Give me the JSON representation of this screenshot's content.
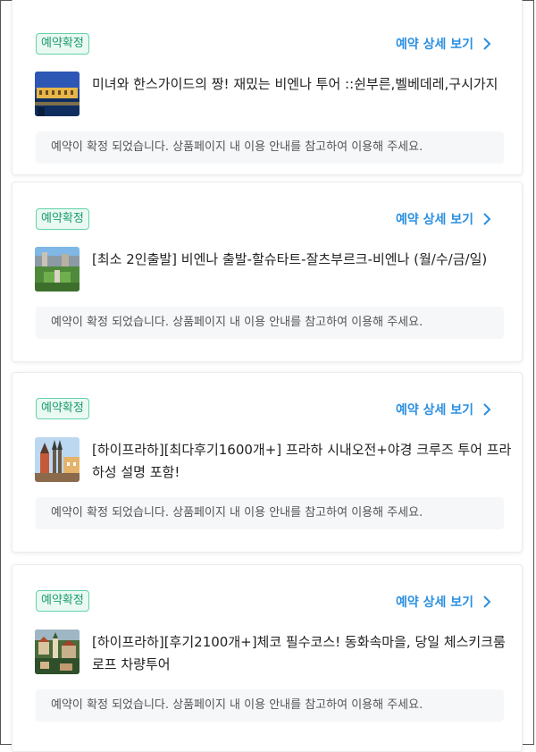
{
  "reservations": [
    {
      "status": "예약확정",
      "detail_link": "예약 상세 보기",
      "title": "미녀와 한스가이드의 짱! 재밌는 비엔나 투어 ::쉰부른,벨베데레,구시가지",
      "notice": "예약이 확정 되었습니다. 상품페이지 내 이용 안내를 참고하여 이용해 주세요.",
      "thumbnail": "schonbrunn-palace-photo"
    },
    {
      "status": "예약확정",
      "detail_link": "예약 상세 보기",
      "title": "[최소 2인출발] 비엔나 출발-할슈타트-잘츠부르크-비엔나 (월/수/금/일)",
      "notice": "예약이 확정 되었습니다. 상품페이지 내 이용 안내를 참고하여 이용해 주세요.",
      "thumbnail": "salzburg-garden-photo"
    },
    {
      "status": "예약확정",
      "detail_link": "예약 상세 보기",
      "title": "[하이프라하][최다후기1600개+] 프라하 시내오전+야경 크루즈 투어 프라하성 설명 포함!",
      "notice": "예약이 확정 되었습니다. 상품페이지 내 이용 안내를 참고하여 이용해 주세요.",
      "thumbnail": "prague-old-town-photo"
    },
    {
      "status": "예약확정",
      "detail_link": "예약 상세 보기",
      "title": "[하이프라하][후기2100개+]체코 필수코스! 동화속마을, 당일 체스키크룸로프 차량투어",
      "notice": "예약이 확정 되었습니다. 상품페이지 내 이용 안내를 참고하여 이용해 주세요.",
      "thumbnail": "cesky-krumlov-photo"
    }
  ],
  "colors": {
    "accent": "#2b8fe0",
    "badge_text": "#1a9b6e",
    "badge_border": "#63d2aa"
  }
}
